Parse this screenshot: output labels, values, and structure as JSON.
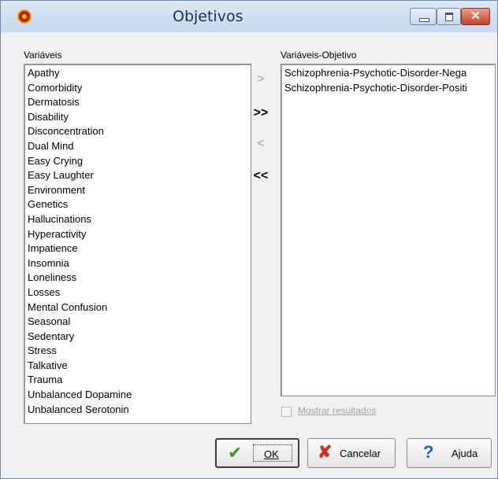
{
  "window": {
    "title": "Objetivos",
    "close_glyph": "✕",
    "icons": {
      "app": "app-logo-icon",
      "minimize": "minimize-icon",
      "maximize": "maximize-icon",
      "close": "close-icon"
    }
  },
  "variables": {
    "label": "Variáveis",
    "items": [
      "Apathy",
      "Comorbidity",
      "Dermatosis",
      "Disability",
      "Disconcentration",
      "Dual Mind",
      "Easy Crying",
      "Easy Laughter",
      "Environment",
      "Genetics",
      "Hallucinations",
      "Hyperactivity",
      "Impatience",
      "Insomnia",
      "Loneliness",
      "Losses",
      "Mental Confusion",
      "Seasonal",
      "Sedentary",
      "Stress",
      "Talkative",
      "Trauma",
      "Unbalanced Dopamine",
      "Unbalanced Serotonin"
    ]
  },
  "targets": {
    "label": "Variáveis-Objetivo",
    "items": [
      "Schizophrenia-Psychotic-Disorder-Nega",
      "Schizophrenia-Psychotic-Disorder-Positi"
    ]
  },
  "move_buttons": {
    "add_one": ">",
    "add_all": ">>",
    "remove_one": "<",
    "remove_all": "<<"
  },
  "show_results": {
    "label": "Mostrar resultados",
    "checked": false,
    "enabled": false
  },
  "buttons": {
    "ok": "OK",
    "cancel": "Cancelar",
    "help": "Ajuda",
    "icons": {
      "ok": "checkmark-icon",
      "cancel": "x-mark-icon",
      "help": "question-mark-icon"
    }
  },
  "colors": {
    "ok_icon": "#3a9a2a",
    "cancel_icon": "#d0321f",
    "help_icon": "#1f62c9",
    "close_button": "#c6412b"
  }
}
